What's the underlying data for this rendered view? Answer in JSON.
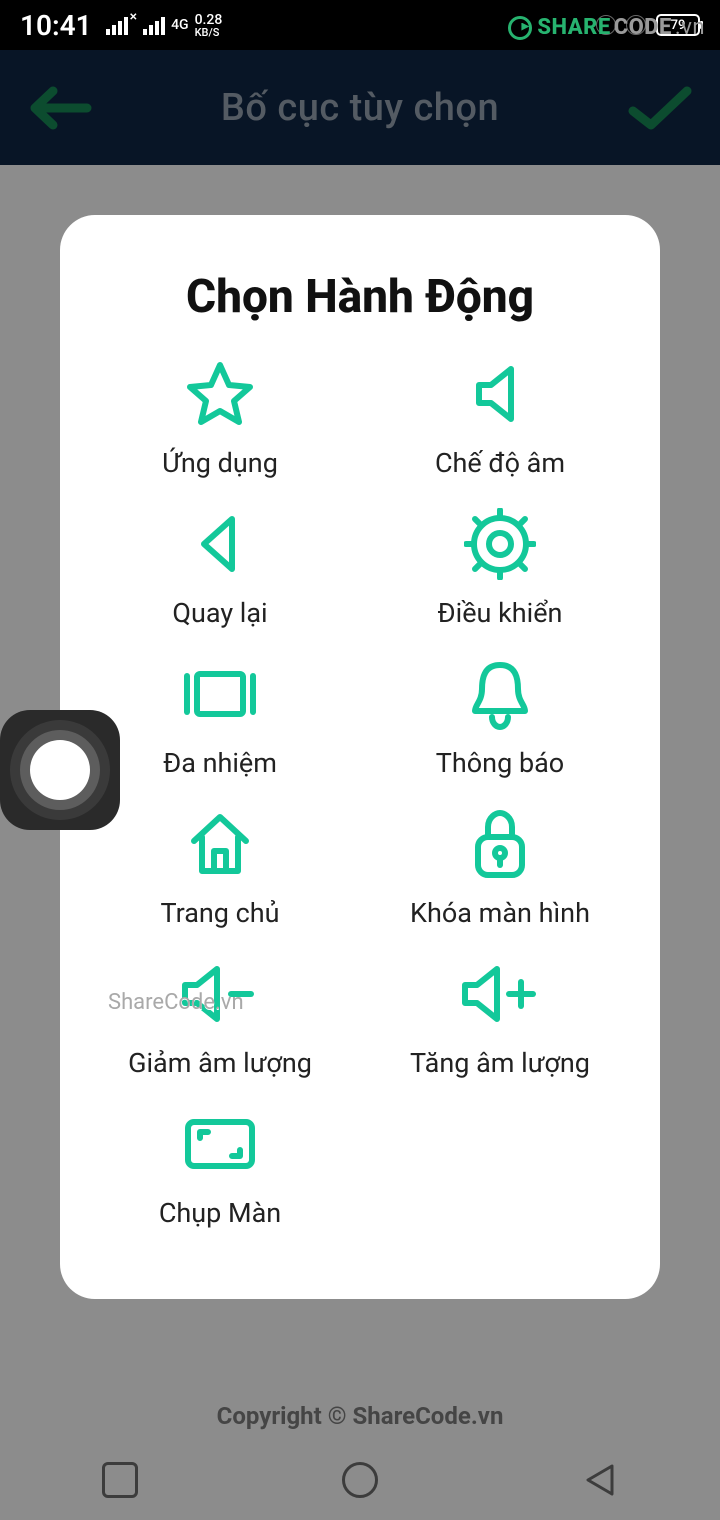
{
  "status": {
    "time": "10:41",
    "net_top": "4G",
    "net_speed": "0.28",
    "net_unit": "KB/S",
    "battery": "79"
  },
  "header": {
    "title": "Bố cục tùy chọn"
  },
  "dialog": {
    "title": "Chọn Hành Động",
    "actions": [
      {
        "key": "apps",
        "label": "Ứng dụng"
      },
      {
        "key": "sound",
        "label": "Chế độ âm"
      },
      {
        "key": "back",
        "label": "Quay lại"
      },
      {
        "key": "control",
        "label": "Điều khiển"
      },
      {
        "key": "multitask",
        "label": "Đa nhiệm"
      },
      {
        "key": "notify",
        "label": "Thông báo"
      },
      {
        "key": "home",
        "label": "Trang chủ"
      },
      {
        "key": "lock",
        "label": "Khóa màn hình"
      },
      {
        "key": "voldown",
        "label": "Giảm âm lượng"
      },
      {
        "key": "volup",
        "label": "Tăng âm lượng"
      },
      {
        "key": "screenshot",
        "label": "Chụp Màn"
      }
    ]
  },
  "footer": {
    "copyright": "Copyright © ShareCode.vn"
  },
  "watermarks": {
    "center": "ShareCode.vn",
    "top_a": "SHARE",
    "top_b": "CODE",
    "top_c": ".vn"
  }
}
